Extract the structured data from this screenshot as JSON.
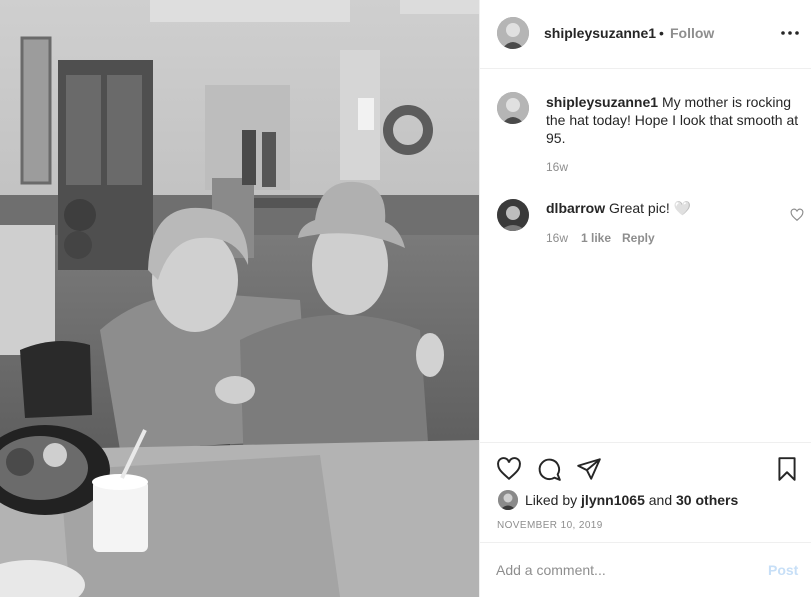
{
  "post": {
    "username": "shipleysuzanne1",
    "separator": "•",
    "follow_label": "Follow",
    "more_icon": "more-options-icon",
    "photo_alt": "Two women smiling at a dining table"
  },
  "comments": [
    {
      "username": "shipleysuzanne1",
      "text": "My mother is rocking the hat today! Hope I look that smooth at 95.",
      "time": "16w"
    },
    {
      "username": "dlbarrow",
      "text": "Great pic! 🤍",
      "time": "16w",
      "likes": "1 like",
      "reply_label": "Reply"
    }
  ],
  "actions": {
    "like_icon": "heart-icon",
    "comment_icon": "comment-icon",
    "share_icon": "share-icon",
    "save_icon": "bookmark-icon"
  },
  "likes": {
    "prefix": "Liked by",
    "user": "jlynn1065",
    "conjunction": "and",
    "others": "30 others"
  },
  "date": "NOVEMBER 10, 2019",
  "add_comment": {
    "placeholder": "Add a comment...",
    "post_label": "Post"
  },
  "colors": {
    "text": "#262626",
    "muted": "#8e8e8e",
    "divider": "#efefef",
    "post_disabled": "#c7dff7"
  }
}
